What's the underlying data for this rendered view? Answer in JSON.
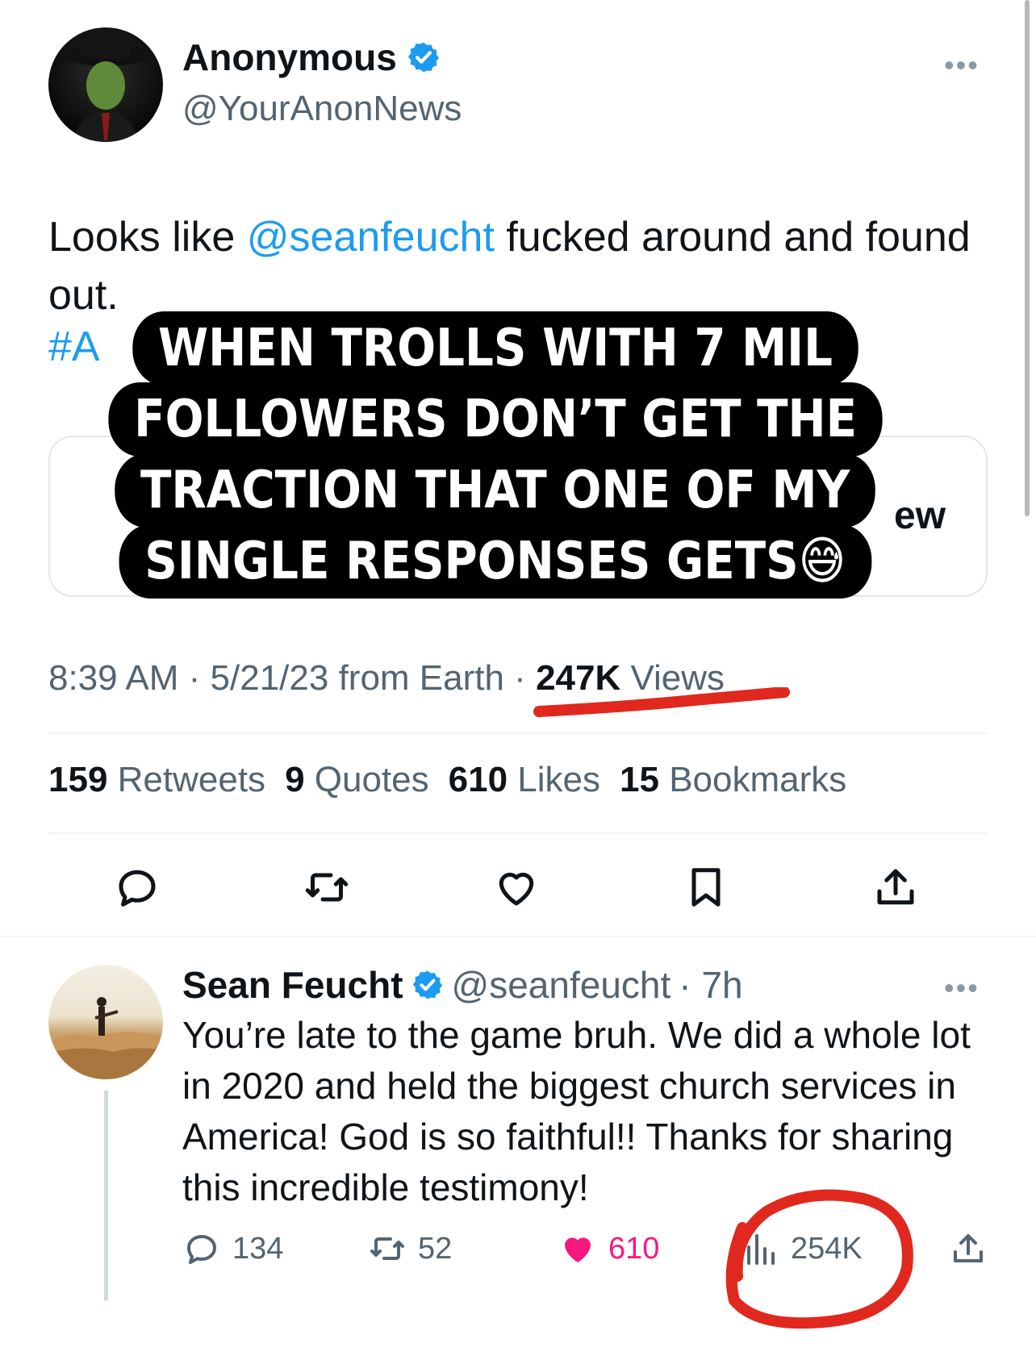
{
  "main_tweet": {
    "display_name": "Anonymous",
    "handle": "@YourAnonNews",
    "more": "•••",
    "text_before": "Looks like ",
    "mention": "@seanfeucht",
    "text_after": " fucked around and found out.",
    "hashtag_fragment": "#A",
    "card_fragment": "ew",
    "timestamp": "8:39 AM · 5/21/23 from Earth · ",
    "views_count": "247K",
    "views_label": " Views",
    "stats": {
      "retweets_count": "159",
      "retweets_label": " Retweets",
      "quotes_count": "9",
      "quotes_label": " Quotes",
      "likes_count": "610",
      "likes_label": " Likes",
      "bookmarks_count": "15",
      "bookmarks_label": " Bookmarks"
    }
  },
  "overlay": {
    "lines": [
      "WHEN TROLLS WITH 7 MIL",
      "FOLLOWERS DON’T GET THE",
      "TRACTION THAT ONE OF MY",
      "SINGLE RESPONSES GETS😅"
    ]
  },
  "reply": {
    "display_name": "Sean Feucht",
    "handle": "@seanfeucht",
    "time": "· 7h",
    "more": "•••",
    "text": "You’re late to the game bruh. We did a whole lot in 2020 and held the biggest church services in America! God is so faithful!! Thanks for sharing this incredible testimony!",
    "replies": "134",
    "retweets": "52",
    "likes": "610",
    "views": "254K"
  },
  "colors": {
    "accent": "#1d9bf0",
    "like": "#f91880",
    "annotation_red": "#e0281e",
    "secondary_text": "#536471"
  }
}
